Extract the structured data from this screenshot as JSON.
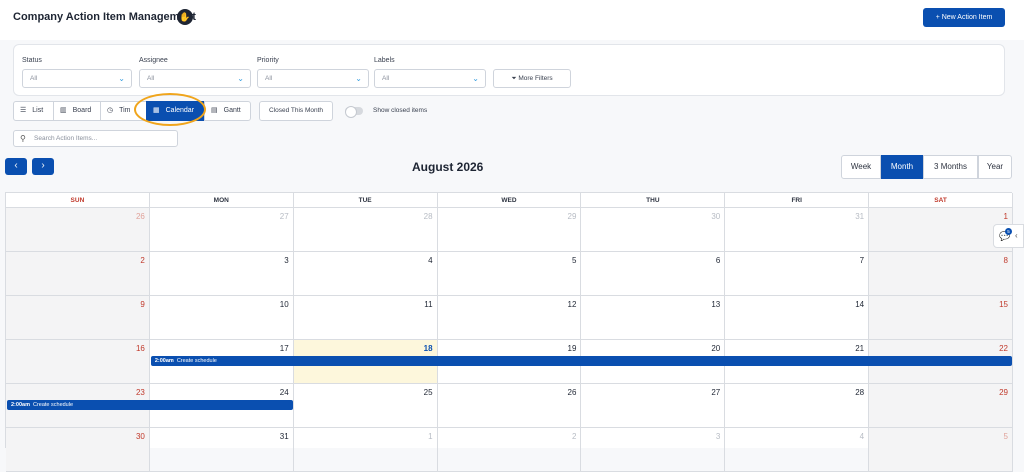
{
  "header": {
    "title": "Company Action Item Management",
    "title_icon": "hand-icon",
    "new_button": "+ New Action Item"
  },
  "filters": {
    "status": {
      "label": "Status",
      "value": "All"
    },
    "assignee": {
      "label": "Assignee",
      "value": "All"
    },
    "priority": {
      "label": "Priority",
      "value": "All"
    },
    "labels": {
      "label": "Labels",
      "value": "All"
    },
    "more": "More Filters"
  },
  "views": {
    "list": "List",
    "board": "Board",
    "timeline": "Tim",
    "calendar": "Calendar",
    "gantt": "Gantt",
    "active": "Calendar"
  },
  "closed_this_month": "Closed This Month",
  "show_closed": {
    "label": "Show closed items",
    "on": false
  },
  "search": {
    "placeholder": "Search Action Items..."
  },
  "calendar": {
    "prev": "‹",
    "next": "›",
    "month_title": "August 2026",
    "ranges": [
      "Week",
      "Month",
      "3 Months",
      "Year"
    ],
    "active_range": "Month",
    "days_of_week": [
      "SUN",
      "MON",
      "TUE",
      "WED",
      "THU",
      "FRI",
      "SAT"
    ],
    "weeks": [
      [
        "26",
        "27",
        "28",
        "29",
        "30",
        "31",
        "1"
      ],
      [
        "2",
        "3",
        "4",
        "5",
        "6",
        "7",
        "8"
      ],
      [
        "9",
        "10",
        "11",
        "12",
        "13",
        "14",
        "15"
      ],
      [
        "16",
        "17",
        "18",
        "19",
        "20",
        "21",
        "22"
      ],
      [
        "23",
        "24",
        "25",
        "26",
        "27",
        "28",
        "29"
      ],
      [
        "30",
        "31",
        "1",
        "2",
        "3",
        "4",
        "5"
      ]
    ],
    "today": "18",
    "events": [
      {
        "time": "2:00am",
        "title": "Create schedule"
      },
      {
        "time": "2:00am",
        "title": "Create schedule"
      }
    ]
  },
  "side_widget": {
    "badge": "5",
    "icon": "chat-icon"
  },
  "colors": {
    "primary": "#0a4fb0",
    "weekend_text": "#c0392b",
    "today_bg": "#fdf7dc",
    "highlight_ring": "#f0a51c"
  }
}
